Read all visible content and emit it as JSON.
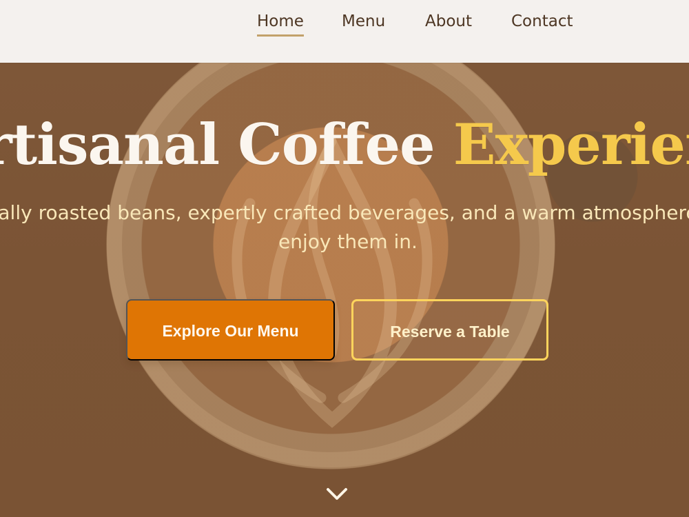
{
  "nav": {
    "items": [
      {
        "label": "Home"
      },
      {
        "label": "Menu"
      },
      {
        "label": "About"
      },
      {
        "label": "Contact"
      }
    ]
  },
  "hero": {
    "title_main": "rtisanal Coffee ",
    "title_accent": "Experienc",
    "subtitle": "ally roasted beans, expertly crafted beverages, and a warm atmosphere enjoy them in.",
    "primary_button": "Explore Our Menu",
    "secondary_button": "Reserve a Table",
    "scroll_icon": "chevron-down-icon"
  },
  "colors": {
    "nav_background": "#f4f1ee",
    "nav_text": "#4d3623",
    "active_underline": "#c2a16a",
    "hero_background": "#7b5435",
    "accent_text": "#f5c94c",
    "primary_button": "#df7504",
    "secondary_button_border": "#ffd45c"
  }
}
